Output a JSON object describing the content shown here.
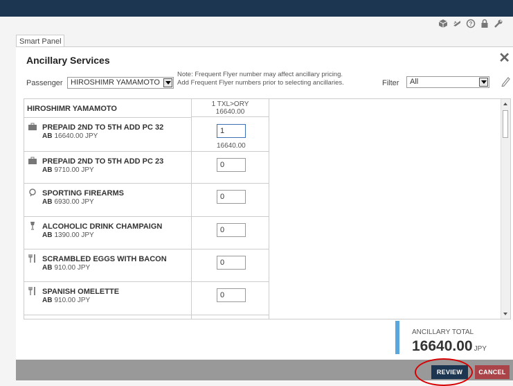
{
  "panel_tab": "Smart Panel",
  "title": "Ancillary Services",
  "passenger": {
    "label": "Passenger",
    "selected": "HIROSHIMR YAMAMOTO"
  },
  "note": {
    "line1": "Note: Frequent Flyer number may affect ancillary pricing.",
    "line2": "Add Frequent Flyer numbers prior to selecting ancillaries."
  },
  "filter": {
    "label": "Filter",
    "selected": "All"
  },
  "grid": {
    "passenger_name": "HIROSHIMR YAMAMOTO",
    "segment": {
      "route": "1 TXL>ORY",
      "amount": "16640.00"
    },
    "rows": [
      {
        "icon": "suitcase-icon",
        "name": "PREPAID 2ND TO 5TH ADD PC 32",
        "carrier": "AB",
        "price": "16640.00 JPY",
        "qty": "1",
        "subtotal": "16640.00"
      },
      {
        "icon": "suitcase-icon",
        "name": "PREPAID 2ND TO 5TH ADD PC 23",
        "carrier": "AB",
        "price": "9710.00 JPY",
        "qty": "0"
      },
      {
        "icon": "sporting-icon",
        "name": "SPORTING FIREARMS",
        "carrier": "AB",
        "price": "6930.00 JPY",
        "qty": "0"
      },
      {
        "icon": "champagne-glass-icon",
        "name": "ALCOHOLIC DRINK CHAMPAIGN",
        "carrier": "AB",
        "price": "1390.00 JPY",
        "qty": "0"
      },
      {
        "icon": "fork-knife-icon",
        "name": "SCRAMBLED EGGS WITH BACON",
        "carrier": "AB",
        "price": "910.00 JPY",
        "qty": "0"
      },
      {
        "icon": "fork-knife-icon",
        "name": "SPANISH OMELETTE",
        "carrier": "AB",
        "price": "910.00 JPY",
        "qty": "0"
      }
    ]
  },
  "total": {
    "label": "ANCILLARY TOTAL",
    "amount": "16640.00",
    "currency": "JPY"
  },
  "buttons": {
    "review": "REVIEW",
    "cancel": "CANCEL"
  },
  "colors": {
    "topbar": "#1c3550",
    "review": "#1c3550",
    "cancel": "#aa4448",
    "total_accent": "#5aa7dd",
    "highlight": "#d60000"
  }
}
